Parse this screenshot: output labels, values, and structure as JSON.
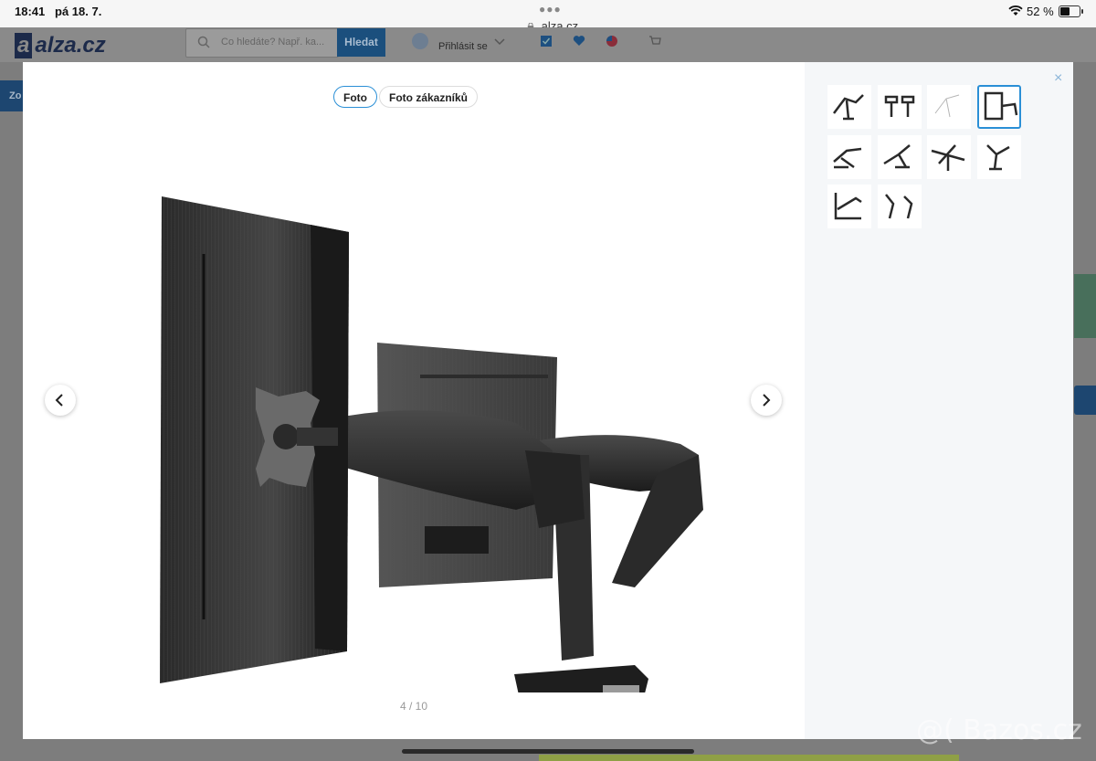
{
  "status_bar": {
    "time": "18:41",
    "date": "pá 18. 7.",
    "url": "alza.cz",
    "battery": "52 %",
    "battery_level_percent": 52
  },
  "page_header": {
    "logo": "alza.cz",
    "search_placeholder": "Co hledáte? Např. ka...",
    "search_button": "Hledat",
    "login": "Přihlásit se",
    "side_button": "Zo"
  },
  "gallery": {
    "tabs": [
      "Foto",
      "Foto zákazníků"
    ],
    "active_tab": "Foto",
    "counter": "4 / 10",
    "current_index": 4,
    "total": 10,
    "close_label": "×"
  },
  "thumbnails": [
    {
      "icon": "monitor-arm-thumb-1"
    },
    {
      "icon": "monitor-arm-thumb-2"
    },
    {
      "icon": "monitor-arm-thumb-3"
    },
    {
      "icon": "monitor-arm-thumb-4",
      "active": true
    },
    {
      "icon": "monitor-arm-thumb-5"
    },
    {
      "icon": "monitor-arm-thumb-6"
    },
    {
      "icon": "monitor-arm-thumb-7"
    },
    {
      "icon": "monitor-arm-thumb-8"
    },
    {
      "icon": "monitor-arm-thumb-9"
    },
    {
      "icon": "monitor-arm-thumb-10"
    }
  ],
  "watermark": "@( Bazos.cz",
  "colors": {
    "accent": "#2a8fd6",
    "brand": "#1c2a4a"
  }
}
